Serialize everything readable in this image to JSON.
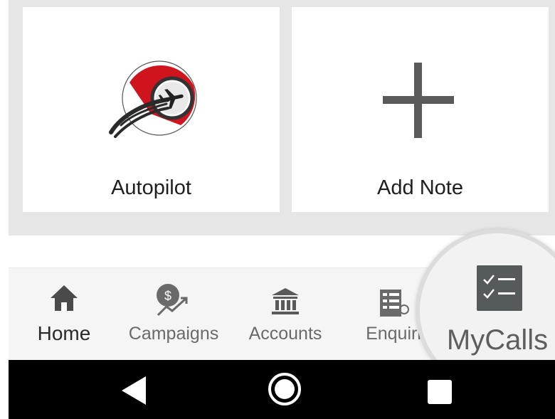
{
  "tiles": [
    {
      "label": "Autopilot",
      "icon": "airplane-logo-icon"
    },
    {
      "label": "Add Note",
      "icon": "plus-icon"
    }
  ],
  "bottom_nav": {
    "items": [
      {
        "label": "Home",
        "icon": "home-icon",
        "active": true
      },
      {
        "label": "Campaigns",
        "icon": "money-growth-icon"
      },
      {
        "label": "Accounts",
        "icon": "bank-icon"
      },
      {
        "label": "Enquiri",
        "icon": "list-icon"
      },
      {
        "label": "MyCalls",
        "icon": "checklist-icon",
        "highlighted": true
      }
    ]
  },
  "system_nav": {
    "back": "back-icon",
    "home": "home-circle-icon",
    "recents": "recents-icon"
  },
  "colors": {
    "accent_red": "#d0141d",
    "icon_gray": "#5a5a5a",
    "nav_text": "#6a6a6a",
    "system_bar": "#000000"
  }
}
